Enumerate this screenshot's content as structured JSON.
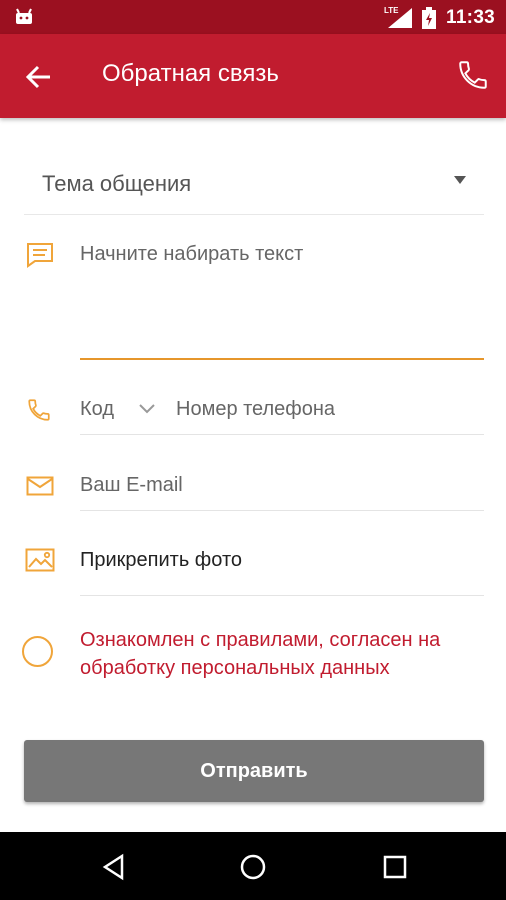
{
  "status_bar": {
    "network_label": "LTE",
    "time": "11:33"
  },
  "app_bar": {
    "title": "Обратная связь",
    "back_icon": "arrow-left-icon",
    "call_icon": "phone-icon"
  },
  "form": {
    "topic_select": {
      "placeholder": "Тема общения"
    },
    "message_field": {
      "placeholder": "Начните набирать текст",
      "value": ""
    },
    "phone": {
      "code_placeholder": "Код",
      "number_placeholder": "Номер телефона"
    },
    "email_field": {
      "placeholder": "Ваш E-mail"
    },
    "attach_photo_label": "Прикрепить фото",
    "consent_label": "Ознакомлен с правилами, согласен на обработку персональных данных",
    "consent_checked": false,
    "submit_label": "Отправить"
  },
  "colors": {
    "status_bar": "#9b1020",
    "app_bar": "#c11c2f",
    "accent_orange": "#e6962b",
    "consent_text": "#c11c2f",
    "submit_button": "#777777"
  }
}
